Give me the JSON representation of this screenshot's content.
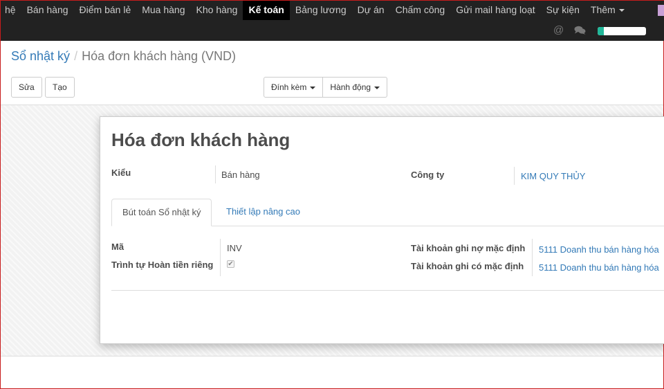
{
  "nav": {
    "items": [
      {
        "label": "hệ",
        "active": false
      },
      {
        "label": "Bán hàng",
        "active": false
      },
      {
        "label": "Điểm bán lẻ",
        "active": false
      },
      {
        "label": "Mua hàng",
        "active": false
      },
      {
        "label": "Kho hàng",
        "active": false
      },
      {
        "label": "Kế toán",
        "active": true
      },
      {
        "label": "Bảng lương",
        "active": false
      },
      {
        "label": "Dự án",
        "active": false
      },
      {
        "label": "Chấm công",
        "active": false
      },
      {
        "label": "Gửi mail hàng loạt",
        "active": false
      },
      {
        "label": "Sự kiện",
        "active": false
      }
    ],
    "more_label": "Thêm",
    "at_symbol": "@",
    "progress_fraction": 0.13,
    "progress_color": "#21b799"
  },
  "breadcrumb": {
    "parent": "Sổ nhật ký",
    "separator": "/",
    "current": "Hóa đơn khách hàng (VND)"
  },
  "toolbar": {
    "edit_label": "Sửa",
    "create_label": "Tạo",
    "attach_label": "Đính kèm",
    "action_label": "Hành động"
  },
  "form": {
    "title": "Hóa đơn khách hàng",
    "type_label": "Kiểu",
    "type_value": "Bán hàng",
    "company_label": "Công ty",
    "company_value": "KIM QUY THỦY",
    "tabs": [
      {
        "label": "Bút toán Sổ nhật ký",
        "active": true
      },
      {
        "label": "Thiết lập nâng cao",
        "active": false
      }
    ],
    "code_label": "Mã",
    "code_value": "INV",
    "refund_seq_label": "Trình tự Hoàn tiền riêng",
    "refund_seq_checked": true,
    "debit_label": "Tài khoản ghi nợ mặc định",
    "debit_value": "5111 Doanh thu bán hàng hóa",
    "credit_label": "Tài khoản ghi có mặc định",
    "credit_value": "5111 Doanh thu bán hàng hóa"
  }
}
